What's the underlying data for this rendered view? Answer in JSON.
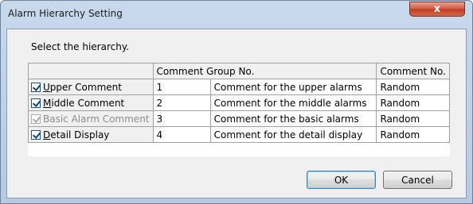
{
  "window": {
    "title": "Alarm Hierarchy Setting",
    "close_glyph": "x"
  },
  "instruction": "Select the hierarchy.",
  "table": {
    "headers": [
      "",
      "Comment Group No.",
      "Comment No."
    ],
    "rows": [
      {
        "accel": "U",
        "label_rest": "pper Comment",
        "checked": true,
        "enabled": true,
        "group_no": "1",
        "comment": "Comment for the upper alarms",
        "comment_no": "Random"
      },
      {
        "accel": "M",
        "label_rest": "iddle Comment",
        "checked": true,
        "enabled": true,
        "group_no": "2",
        "comment": "Comment for the middle alarms",
        "comment_no": "Random"
      },
      {
        "accel": "",
        "label_rest": "Basic Alarm Comment",
        "checked": true,
        "enabled": false,
        "group_no": "3",
        "comment": "Comment for the basic alarms",
        "comment_no": "Random"
      },
      {
        "accel": "D",
        "label_rest": "etail Display",
        "checked": true,
        "enabled": true,
        "group_no": "4",
        "comment": "Comment for the detail display",
        "comment_no": "Random"
      }
    ]
  },
  "buttons": {
    "ok": "OK",
    "cancel": "Cancel"
  }
}
